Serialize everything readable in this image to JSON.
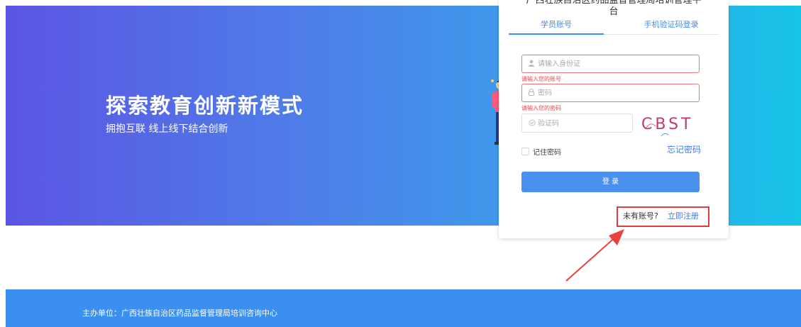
{
  "hero": {
    "title": "探索教育创新新模式",
    "subtitle": "拥抱互联  线上线下结合创新"
  },
  "login": {
    "title_line1": "广西壮族自治区药品监督管理局培训管理平",
    "title_line2": "台",
    "tabs": [
      "学员账号",
      "手机验证码登录"
    ],
    "active_tab": "学员账号",
    "id_placeholder": "请输入身份证",
    "id_error": "请输入您的账号",
    "password_placeholder": "密码",
    "password_error": "请输入您的密码",
    "captcha_placeholder": "验证码",
    "captcha_text": "CBST",
    "remember_label": "记住密码",
    "forgot_label": "忘记密码",
    "submit_label": "登 录",
    "no_account_label": "未有账号?",
    "register_label": "立即注册"
  },
  "footer": {
    "organizer": "主办单位：广西壮族自治区药品监督管理局培训咨询中心"
  },
  "colors": {
    "accent": "#3c8ef0",
    "error": "#e0464d",
    "highlight": "#e23b3b"
  },
  "icons": {
    "id_field": "user-icon",
    "password_field": "lock-icon",
    "captcha_field": "shield-icon",
    "annotation": "red-arrow-icon"
  }
}
